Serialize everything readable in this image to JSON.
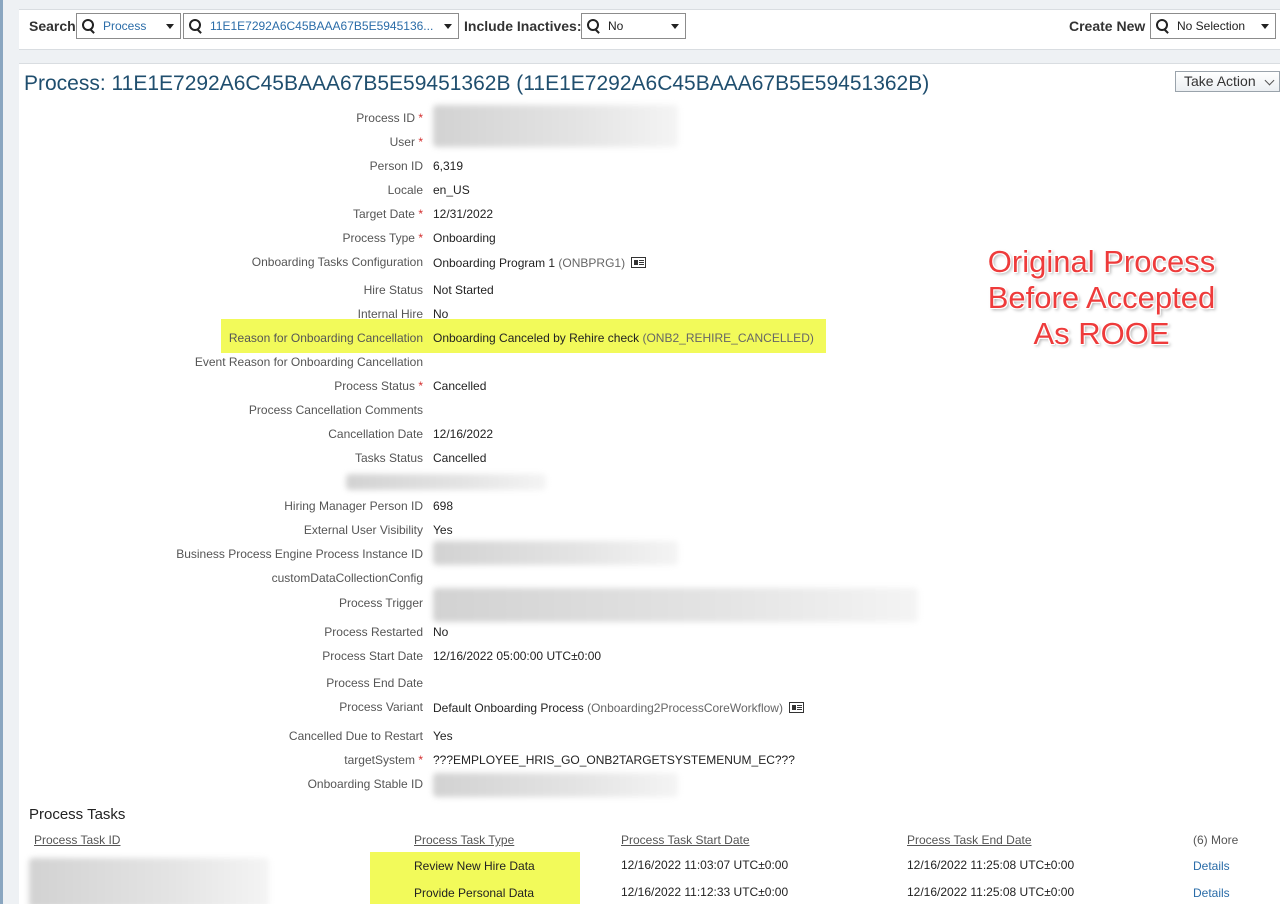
{
  "search_bar": {
    "search_label": "Search",
    "object_type": "Process",
    "object_value": "11E1E7292A6C45BAAA67B5E5945136...",
    "include_inactives_label": "Include Inactives:",
    "include_inactives_value": "No",
    "create_new_label": "Create New",
    "create_new_value": "No Selection"
  },
  "header": {
    "title": "Process: 11E1E7292A6C45BAAA67B5E59451362B (11E1E7292A6C45BAAA67B5E59451362B)",
    "take_action": "Take Action"
  },
  "fields": {
    "process_id": {
      "label": "Process ID",
      "req": "*",
      "value": ""
    },
    "user": {
      "label": "User",
      "req": "*",
      "value": ""
    },
    "person_id": {
      "label": "Person ID",
      "value": "6,319"
    },
    "locale": {
      "label": "Locale",
      "value": "en_US"
    },
    "target_date": {
      "label": "Target Date",
      "req": "*",
      "value": "12/31/2022"
    },
    "process_type": {
      "label": "Process Type",
      "req": "*",
      "value": "Onboarding"
    },
    "tasks_config": {
      "label": "Onboarding Tasks Configuration",
      "value": "Onboarding Program 1",
      "code": "(ONBPRG1)"
    },
    "hire_status": {
      "label": "Hire Status",
      "value": "Not Started"
    },
    "internal_hire": {
      "label": "Internal Hire",
      "value": "No"
    },
    "cancel_reason": {
      "label": "Reason for Onboarding Cancellation",
      "value": "Onboarding Canceled by Rehire check",
      "code": "(ONB2_REHIRE_CANCELLED)"
    },
    "event_reason": {
      "label": "Event Reason for Onboarding Cancellation",
      "value": ""
    },
    "process_status": {
      "label": "Process Status",
      "req": "*",
      "value": "Cancelled"
    },
    "cancel_comments": {
      "label": "Process Cancellation Comments",
      "value": ""
    },
    "cancel_date": {
      "label": "Cancellation Date",
      "value": "12/16/2022"
    },
    "tasks_status": {
      "label": "Tasks Status",
      "value": "Cancelled"
    },
    "hiring_manager": {
      "label": "Hiring Manager Person ID",
      "value": "698"
    },
    "ext_visibility": {
      "label": "External User Visibility",
      "value": "Yes"
    },
    "bpe_instance": {
      "label": "Business Process Engine Process Instance ID",
      "value": ""
    },
    "custom_config": {
      "label": "customDataCollectionConfig",
      "value": ""
    },
    "process_trigger": {
      "label": "Process Trigger",
      "value": ""
    },
    "restarted": {
      "label": "Process Restarted",
      "value": "No"
    },
    "start_date": {
      "label": "Process Start Date",
      "value": "12/16/2022 05:00:00 UTC±0:00"
    },
    "end_date": {
      "label": "Process End Date",
      "value": ""
    },
    "variant": {
      "label": "Process Variant",
      "value": "Default Onboarding Process",
      "code": "(Onboarding2ProcessCoreWorkflow)"
    },
    "cancelled_restart": {
      "label": "Cancelled Due to Restart",
      "value": "Yes"
    },
    "target_system": {
      "label": "targetSystem",
      "req": "*",
      "value": "???EMPLOYEE_HRIS_GO_ONB2TARGETSYSTEMENUM_EC???"
    },
    "stable_id": {
      "label": "Onboarding Stable ID",
      "value": ""
    }
  },
  "annotation": {
    "line1": "Original Process",
    "line2": "Before Accepted",
    "line3": "As ROOE",
    "color": "#ee3b3b"
  },
  "tasks": {
    "title": "Process Tasks",
    "columns": [
      "Process Task ID",
      "Process Task Type",
      "Process Task Start Date",
      "Process Task End Date"
    ],
    "more": "(6) More",
    "rows": [
      {
        "type": "Review New Hire Data",
        "start": "12/16/2022 11:03:07 UTC±0:00",
        "end": "12/16/2022 11:25:08 UTC±0:00",
        "action": "Details"
      },
      {
        "type": "Provide Personal Data",
        "start": "12/16/2022 11:12:33 UTC±0:00",
        "end": "12/16/2022 11:25:08 UTC±0:00",
        "action": "Details"
      }
    ]
  },
  "colors": {
    "highlight": "#f2fa5a",
    "title": "#1f4e6e",
    "link": "#2a6ca8"
  }
}
